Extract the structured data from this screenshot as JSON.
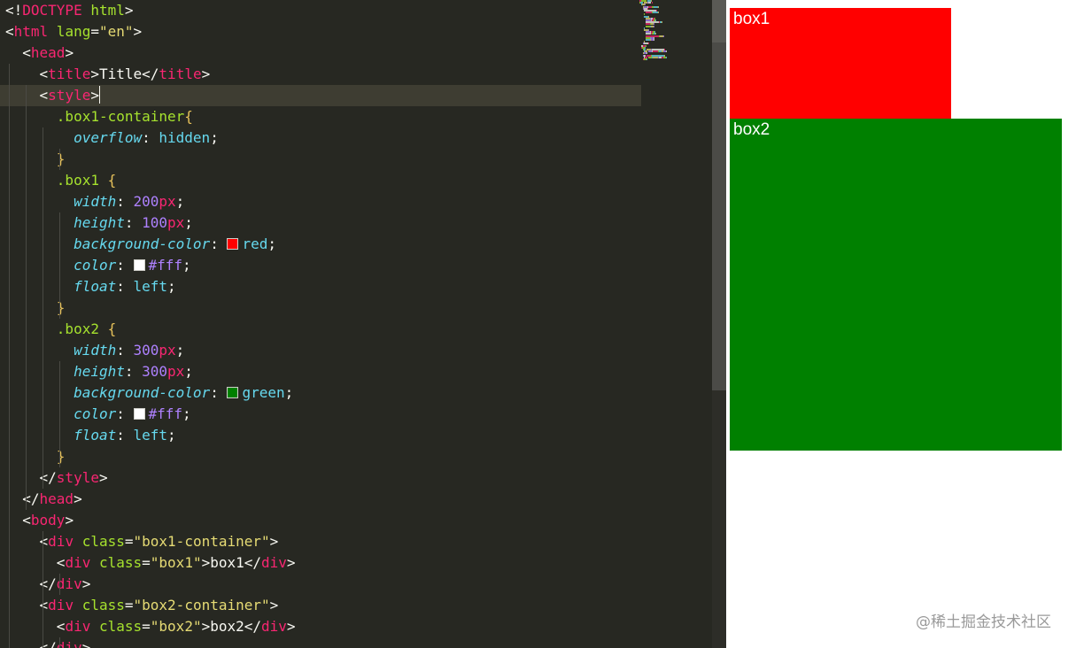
{
  "editor": {
    "lines": [
      [
        {
          "c": "t-punc",
          "t": "<!"
        },
        {
          "c": "t-doct",
          "t": "DOCTYPE"
        },
        {
          "c": "t-attr",
          "t": " html"
        },
        {
          "c": "t-punc",
          "t": ">"
        }
      ],
      [
        {
          "c": "t-punc",
          "t": "<"
        },
        {
          "c": "t-tag",
          "t": "html"
        },
        {
          "c": "t-attr",
          "t": " lang"
        },
        {
          "c": "t-punc",
          "t": "="
        },
        {
          "c": "t-str",
          "t": "\"en\""
        },
        {
          "c": "t-punc",
          "t": ">"
        }
      ],
      [
        {
          "c": "t-punc",
          "t": "  <"
        },
        {
          "c": "t-tag",
          "t": "head"
        },
        {
          "c": "t-punc",
          "t": ">"
        }
      ],
      [
        {
          "c": "t-punc",
          "t": "    <"
        },
        {
          "c": "t-tag",
          "t": "title"
        },
        {
          "c": "t-punc",
          "t": ">"
        },
        {
          "c": "t-text",
          "t": "Title"
        },
        {
          "c": "t-punc",
          "t": "</"
        },
        {
          "c": "t-tag",
          "t": "title"
        },
        {
          "c": "t-punc",
          "t": ">"
        }
      ],
      [
        {
          "c": "t-punc",
          "t": "    <"
        },
        {
          "c": "t-tag",
          "t": "style"
        },
        {
          "c": "t-punc",
          "t": ">"
        },
        {
          "caret": true
        }
      ],
      [
        {
          "c": "t-sel",
          "t": "      .box1-container"
        },
        {
          "c": "t-brace",
          "t": "{"
        }
      ],
      [
        {
          "c": "t-prop",
          "t": "        overflow"
        },
        {
          "c": "t-punc",
          "t": ": "
        },
        {
          "c": "t-val",
          "t": "hidden"
        },
        {
          "c": "t-punc",
          "t": ";"
        }
      ],
      [
        {
          "c": "t-brace",
          "t": "      }"
        }
      ],
      [
        {
          "c": "t-sel",
          "t": "      .box1 "
        },
        {
          "c": "t-brace",
          "t": "{"
        }
      ],
      [
        {
          "c": "t-prop",
          "t": "        width"
        },
        {
          "c": "t-punc",
          "t": ": "
        },
        {
          "c": "t-num",
          "t": "200"
        },
        {
          "c": "t-unit",
          "t": "px"
        },
        {
          "c": "t-punc",
          "t": ";"
        }
      ],
      [
        {
          "c": "t-prop",
          "t": "        height"
        },
        {
          "c": "t-punc",
          "t": ": "
        },
        {
          "c": "t-num",
          "t": "100"
        },
        {
          "c": "t-unit",
          "t": "px"
        },
        {
          "c": "t-punc",
          "t": ";"
        }
      ],
      [
        {
          "c": "t-prop",
          "t": "        background-color"
        },
        {
          "c": "t-punc",
          "t": ": "
        },
        {
          "swatch": "#ff0000"
        },
        {
          "c": "t-val",
          "t": "red"
        },
        {
          "c": "t-punc",
          "t": ";"
        }
      ],
      [
        {
          "c": "t-prop",
          "t": "        color"
        },
        {
          "c": "t-punc",
          "t": ": "
        },
        {
          "swatch": "#ffffff"
        },
        {
          "c": "t-num",
          "t": "#fff"
        },
        {
          "c": "t-punc",
          "t": ";"
        }
      ],
      [
        {
          "c": "t-prop",
          "t": "        float"
        },
        {
          "c": "t-punc",
          "t": ": "
        },
        {
          "c": "t-val",
          "t": "left"
        },
        {
          "c": "t-punc",
          "t": ";"
        }
      ],
      [
        {
          "c": "t-brace",
          "t": "      }"
        }
      ],
      [
        {
          "c": "t-sel",
          "t": "      .box2 "
        },
        {
          "c": "t-brace",
          "t": "{"
        }
      ],
      [
        {
          "c": "t-prop",
          "t": "        width"
        },
        {
          "c": "t-punc",
          "t": ": "
        },
        {
          "c": "t-num",
          "t": "300"
        },
        {
          "c": "t-unit",
          "t": "px"
        },
        {
          "c": "t-punc",
          "t": ";"
        }
      ],
      [
        {
          "c": "t-prop",
          "t": "        height"
        },
        {
          "c": "t-punc",
          "t": ": "
        },
        {
          "c": "t-num",
          "t": "300"
        },
        {
          "c": "t-unit",
          "t": "px"
        },
        {
          "c": "t-punc",
          "t": ";"
        }
      ],
      [
        {
          "c": "t-prop",
          "t": "        background-color"
        },
        {
          "c": "t-punc",
          "t": ": "
        },
        {
          "swatch": "#008000"
        },
        {
          "c": "t-val",
          "t": "green"
        },
        {
          "c": "t-punc",
          "t": ";"
        }
      ],
      [
        {
          "c": "t-prop",
          "t": "        color"
        },
        {
          "c": "t-punc",
          "t": ": "
        },
        {
          "swatch": "#ffffff"
        },
        {
          "c": "t-num",
          "t": "#fff"
        },
        {
          "c": "t-punc",
          "t": ";"
        }
      ],
      [
        {
          "c": "t-prop",
          "t": "        float"
        },
        {
          "c": "t-punc",
          "t": ": "
        },
        {
          "c": "t-val",
          "t": "left"
        },
        {
          "c": "t-punc",
          "t": ";"
        }
      ],
      [
        {
          "c": "t-brace",
          "t": "      }"
        }
      ],
      [
        {
          "c": "t-punc",
          "t": "    </"
        },
        {
          "c": "t-tag",
          "t": "style"
        },
        {
          "c": "t-punc",
          "t": ">"
        }
      ],
      [
        {
          "c": "t-punc",
          "t": "  </"
        },
        {
          "c": "t-tag",
          "t": "head"
        },
        {
          "c": "t-punc",
          "t": ">"
        }
      ],
      [
        {
          "c": "t-punc",
          "t": "  <"
        },
        {
          "c": "t-tag",
          "t": "body"
        },
        {
          "c": "t-punc",
          "t": ">"
        }
      ],
      [
        {
          "c": "t-punc",
          "t": "    <"
        },
        {
          "c": "t-tag",
          "t": "div"
        },
        {
          "c": "t-attr",
          "t": " class"
        },
        {
          "c": "t-punc",
          "t": "="
        },
        {
          "c": "t-str",
          "t": "\"box1-container\""
        },
        {
          "c": "t-punc",
          "t": ">"
        }
      ],
      [
        {
          "c": "t-punc",
          "t": "      <"
        },
        {
          "c": "t-tag",
          "t": "div"
        },
        {
          "c": "t-attr",
          "t": " class"
        },
        {
          "c": "t-punc",
          "t": "="
        },
        {
          "c": "t-str",
          "t": "\"box1\""
        },
        {
          "c": "t-punc",
          "t": ">"
        },
        {
          "c": "t-text",
          "t": "box1"
        },
        {
          "c": "t-punc",
          "t": "</"
        },
        {
          "c": "t-tag",
          "t": "div"
        },
        {
          "c": "t-punc",
          "t": ">"
        }
      ],
      [
        {
          "c": "t-punc",
          "t": "    </"
        },
        {
          "c": "t-tag",
          "t": "div"
        },
        {
          "c": "t-punc",
          "t": ">"
        }
      ],
      [
        {
          "c": "t-punc",
          "t": "    <"
        },
        {
          "c": "t-tag",
          "t": "div"
        },
        {
          "c": "t-attr",
          "t": " class"
        },
        {
          "c": "t-punc",
          "t": "="
        },
        {
          "c": "t-str",
          "t": "\"box2-container\""
        },
        {
          "c": "t-punc",
          "t": ">"
        }
      ],
      [
        {
          "c": "t-punc",
          "t": "      <"
        },
        {
          "c": "t-tag",
          "t": "div"
        },
        {
          "c": "t-attr",
          "t": " class"
        },
        {
          "c": "t-punc",
          "t": "="
        },
        {
          "c": "t-str",
          "t": "\"box2\""
        },
        {
          "c": "t-punc",
          "t": ">"
        },
        {
          "c": "t-text",
          "t": "box2"
        },
        {
          "c": "t-punc",
          "t": "</"
        },
        {
          "c": "t-tag",
          "t": "div"
        },
        {
          "c": "t-punc",
          "t": ">"
        }
      ],
      [
        {
          "c": "t-punc",
          "t": "    </"
        },
        {
          "c": "t-tag",
          "t": "div"
        },
        {
          "c": "t-punc",
          "t": ">"
        }
      ]
    ],
    "current_line": 4,
    "colors": {
      "background": "#272822",
      "current_line": "#3e3d32"
    }
  },
  "preview": {
    "box1": {
      "label": "box1",
      "color": "#ff0000"
    },
    "box2": {
      "label": "box2",
      "color": "#008000"
    },
    "watermark": "@稀土掘金技术社区"
  }
}
